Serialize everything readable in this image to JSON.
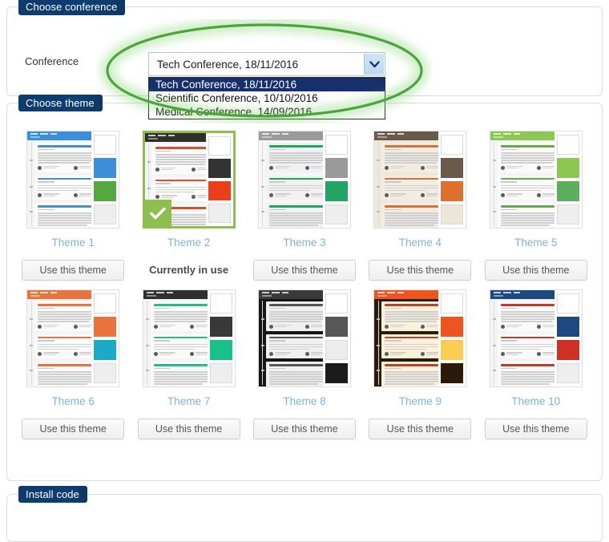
{
  "panels": {
    "conference": {
      "title": "Choose conference"
    },
    "theme": {
      "title": "Choose theme"
    },
    "install": {
      "title": "Install code"
    }
  },
  "conference": {
    "field_label": "Conference",
    "selected_value": "Tech Conference, 18/11/2016",
    "dropdown_open": true,
    "options": [
      {
        "label": "Tech Conference, 18/11/2016",
        "selected": true
      },
      {
        "label": "Scientific Conference, 10/10/2016",
        "selected": false
      },
      {
        "label": "Medical Conference, 14/09/2016",
        "selected": false
      }
    ],
    "arrow_icon": "chevron-down-icon"
  },
  "annotation": {
    "shape": "ellipse",
    "color": "#4aa53c",
    "glow": "#7fd06a"
  },
  "theme_section": {
    "use_button_label": "Use this theme",
    "current_label": "Currently in use",
    "check_icon": "check-icon",
    "themes": [
      {
        "name": "Theme 1",
        "current": false,
        "nav": "#3b8ed8",
        "page_bg": "#f3f4f5",
        "card_bg": "#fbfbfb",
        "heading": "#4a8ec2",
        "accent": "#5cb85c",
        "swatches": [
          "#ffffff",
          "#3b8ed8",
          "#53a93f",
          "#eeeeee"
        ]
      },
      {
        "name": "Theme 2",
        "current": true,
        "nav": "#2f2f2f",
        "page_bg": "#f4f4f4",
        "card_bg": "#fcfcfc",
        "heading": "#e04b2a",
        "accent": "#e8431d",
        "swatches": [
          "#ffffff",
          "#333333",
          "#ea3f1a",
          "#eeeeee"
        ]
      },
      {
        "name": "Theme 3",
        "current": false,
        "nav": "#9a9a9a",
        "page_bg": "#f6f6f6",
        "card_bg": "#f1f1f1",
        "heading": "#21a363",
        "accent": "#20a05f",
        "swatches": [
          "#ffffff",
          "#9a9a9a",
          "#21a363",
          "#eeeeee"
        ]
      },
      {
        "name": "Theme 4",
        "current": false,
        "nav": "#6b5a4b",
        "page_bg": "#efe7da",
        "card_bg": "#f3ece1",
        "heading": "#d4703a",
        "accent": "#de6f2c",
        "swatches": [
          "#ffffff",
          "#6b5a4b",
          "#de6f2c",
          "#ece5d8"
        ]
      },
      {
        "name": "Theme 5",
        "current": false,
        "nav": "#8cc751",
        "page_bg": "#f5f5f5",
        "card_bg": "#fafafa",
        "heading": "#6aa84f",
        "accent": "#62b35a",
        "swatches": [
          "#ffffff",
          "#8cc751",
          "#5aaf5c",
          "#eeeeee"
        ]
      },
      {
        "name": "Theme 6",
        "current": false,
        "nav": "#e8743b",
        "page_bg": "#f4f4f4",
        "card_bg": "#fafafa",
        "heading": "#e8743b",
        "accent": "#1fa8c4",
        "swatches": [
          "#ffffff",
          "#e8743b",
          "#1aa9c6",
          "#eeeeee"
        ]
      },
      {
        "name": "Theme 7",
        "current": false,
        "nav": "#2f2f2f",
        "page_bg": "#f4f4f4",
        "card_bg": "#fafafa",
        "heading": "#1fbd8b",
        "accent": "#19c08a",
        "swatches": [
          "#ffffff",
          "#383838",
          "#19c08a",
          "#eeeeee"
        ]
      },
      {
        "name": "Theme 8",
        "current": false,
        "nav": "#3a3a3a",
        "page_bg": "#151515",
        "card_bg": "#f0f0f0",
        "heading": "#555555",
        "accent": "#888888",
        "swatches": [
          "#ffffff",
          "#575757",
          "#ececec",
          "#1b1b1b"
        ]
      },
      {
        "name": "Theme 9",
        "current": false,
        "nav": "#f0541e",
        "page_bg": "#2b1c08",
        "card_bg": "#fbf0d9",
        "heading": "#b5442a",
        "accent": "#f0541e",
        "swatches": [
          "#ffffff",
          "#f0541e",
          "#fbcd52",
          "#2b1a07"
        ]
      },
      {
        "name": "Theme 10",
        "current": false,
        "nav": "#1c4a80",
        "page_bg": "#f4f4f4",
        "card_bg": "#fafafa",
        "heading": "#c0392b",
        "accent": "#cf3023",
        "swatches": [
          "#ffffff",
          "#1c4a80",
          "#cf3023",
          "#eeeeee"
        ]
      }
    ]
  }
}
